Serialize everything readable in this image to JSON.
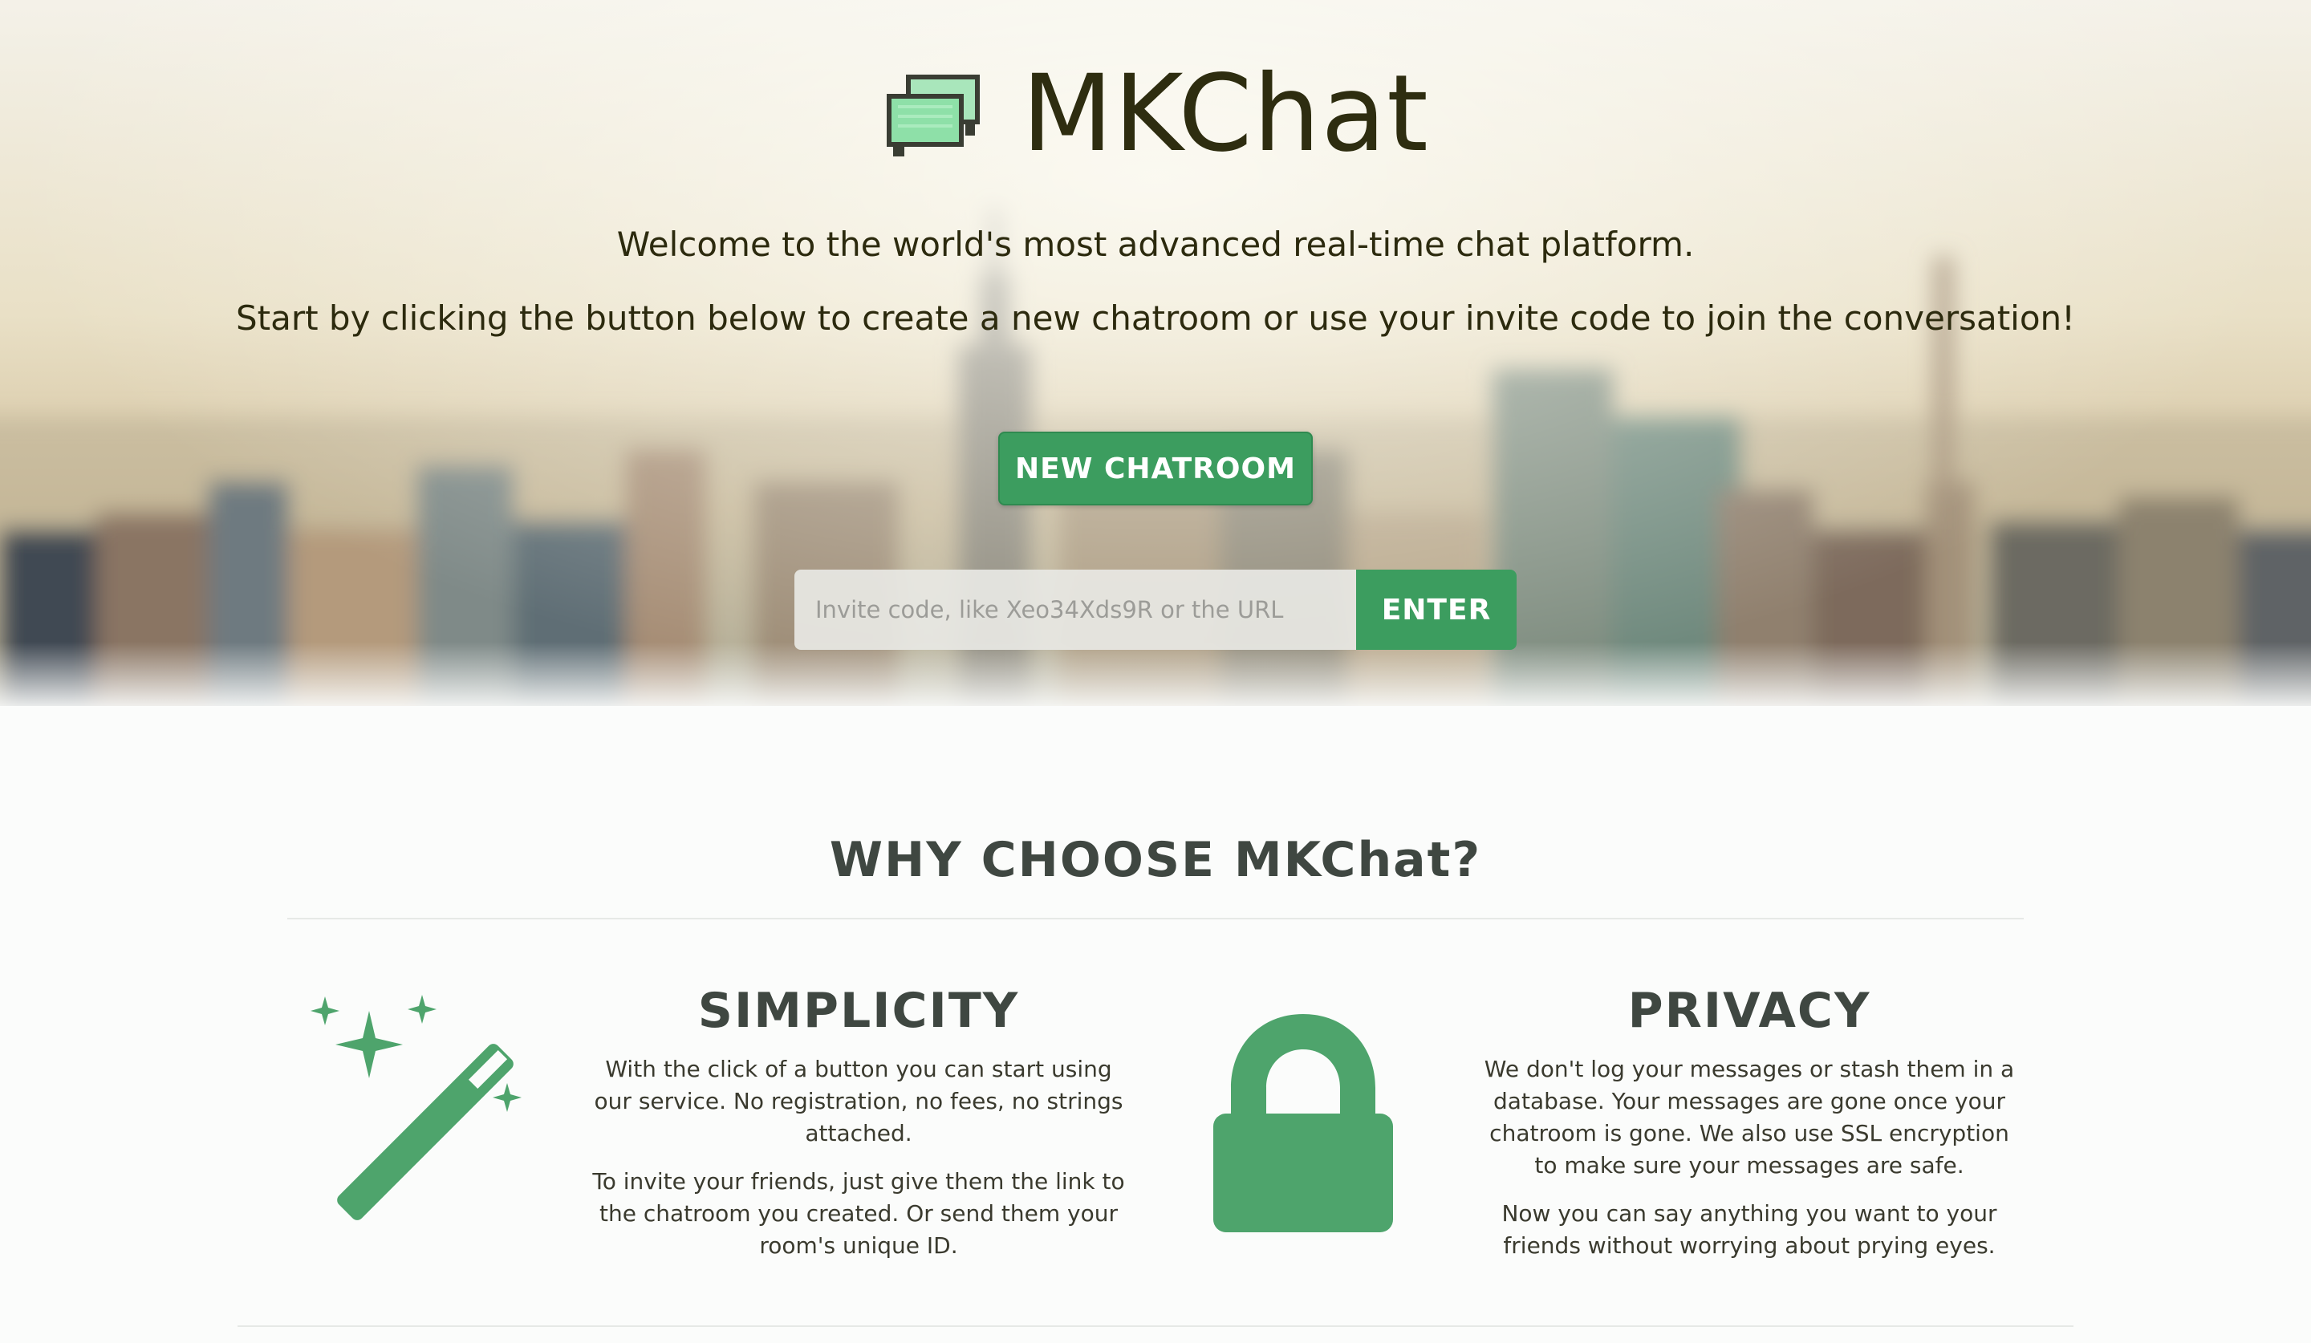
{
  "brand": {
    "title": "MKChat",
    "logo_icon": "chat-bubbles-icon"
  },
  "hero": {
    "welcome": "Welcome to the world's most advanced real-time chat platform.",
    "instructions": "Start by clicking the button below to create a new chatroom or use your invite code to join the conversation!",
    "new_chatroom_label": "NEW CHATROOM",
    "invite_placeholder": "Invite code, like Xeo34Xds9R or the URL",
    "invite_value": "",
    "enter_label": "ENTER"
  },
  "why": {
    "heading": "WHY CHOOSE MKChat?"
  },
  "features": {
    "simplicity": {
      "icon": "magic-wand-icon",
      "title": "SIMPLICITY",
      "p1": "With the click of a button you can start using our service. No registration, no fees, no strings attached.",
      "p2": "To invite your friends, just give them the link to the chatroom you created. Or send them your room's unique ID."
    },
    "privacy": {
      "icon": "lock-icon",
      "title": "PRIVACY",
      "p1": "We don't log your messages or stash them in a database. Your messages are gone once your chatroom is gone. We also use SSL encryption to make sure your messages are safe.",
      "p2": "Now you can say anything you want to your friends without worrying about prying eyes."
    }
  },
  "colors": {
    "accent": "#3c9d5f",
    "icon_green": "#4ea46c",
    "title_dark": "#2e2d10",
    "heading_gray": "#3f4741"
  }
}
